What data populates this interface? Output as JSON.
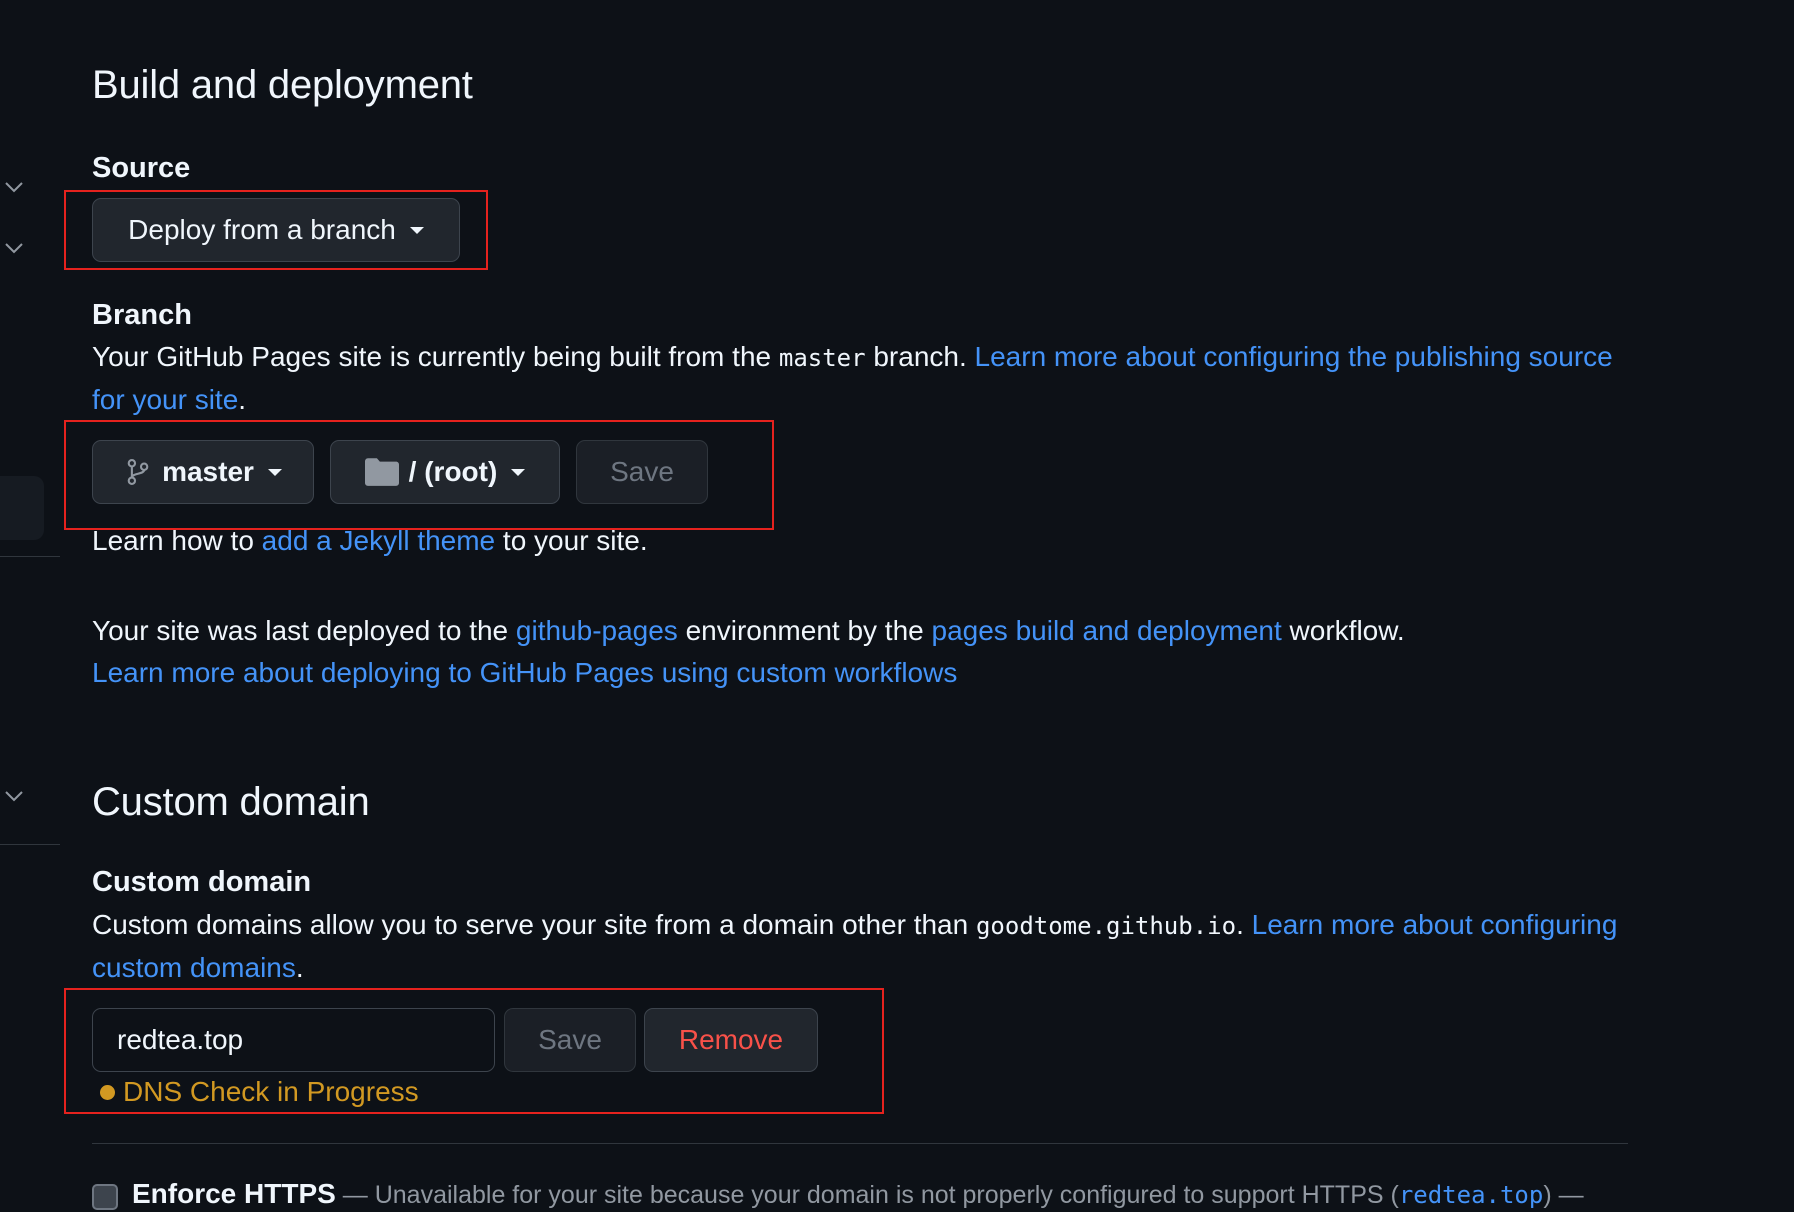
{
  "build": {
    "heading": "Build and deployment",
    "source_label": "Source",
    "source_dropdown": "Deploy from a branch",
    "branch_label": "Branch",
    "branch_desc_pre": "Your GitHub Pages site is currently being built from the ",
    "branch_desc_code": "master",
    "branch_desc_mid": " branch. ",
    "branch_desc_link": "Learn more about configuring the publishing source for your site",
    "branch_desc_post": ".",
    "branch_button": "master",
    "folder_button": "/ (root)",
    "save_button": "Save",
    "jekyll_pre": "Learn how to ",
    "jekyll_link": "add a Jekyll theme",
    "jekyll_post": " to your site.",
    "deploy_pre": "Your site was last deployed to the ",
    "deploy_env_link": "github-pages",
    "deploy_mid": " environment by the ",
    "deploy_workflow_link": "pages build and deployment",
    "deploy_post": " workflow.",
    "deploy_learn_link": "Learn more about deploying to GitHub Pages using custom workflows"
  },
  "custom_domain": {
    "heading": "Custom domain",
    "label": "Custom domain",
    "desc_pre": "Custom domains allow you to serve your site from a domain other than ",
    "desc_code": "goodtome.github.io",
    "desc_mid": ". ",
    "desc_link": "Learn more about configuring custom domains",
    "desc_post": ".",
    "input_value": "redtea.top",
    "save_button": "Save",
    "remove_button": "Remove",
    "status": "DNS Check in Progress"
  },
  "https": {
    "title": "Enforce HTTPS",
    "desc_pre": " — Unavailable for your site because your domain is not properly configured to support HTTPS (",
    "desc_code": "redtea.top",
    "desc_post": ") —"
  },
  "colors": {
    "background": "#0d1117",
    "link": "#4493f8",
    "danger": "#f85149",
    "warning": "#d29922",
    "highlight_box": "#e5221e"
  },
  "icons": [
    "chevron-down-icon",
    "git-branch-icon",
    "folder-icon",
    "caret-down-icon"
  ]
}
